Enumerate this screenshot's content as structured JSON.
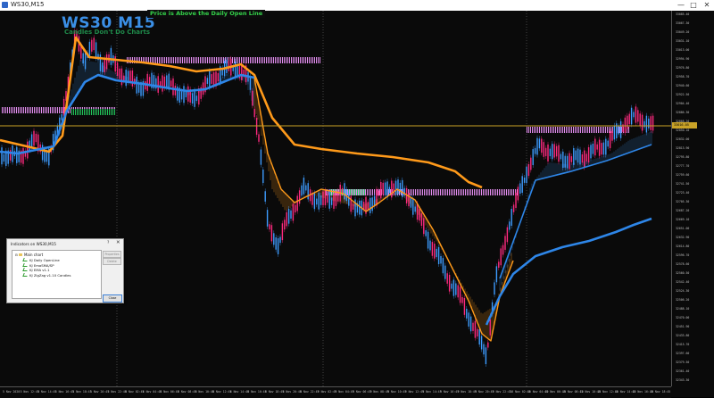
{
  "window": {
    "title": "WS30,M15",
    "minimize": "—",
    "maximize": "□",
    "close": "✕"
  },
  "chart": {
    "symbol_timeframe": "WS30 M15",
    "watermark": "Candles Don't Do Charts",
    "status_banner": "Price is Above the Daily Open Line",
    "current_price": "33016.05",
    "colors": {
      "bull_candle": "#3d9cff",
      "bear_candle": "#ff2a7f",
      "ema_slow": "#2e86e8",
      "orange_line": "#ff9a1a",
      "daily_open_line": "#c9a227",
      "zone": "#e38df0",
      "zone_green": "#22c35a"
    },
    "price_ticks": [
      "33085.40",
      "33067.30",
      "33049.20",
      "33031.10",
      "33013.00",
      "32994.90",
      "32976.80",
      "32958.70",
      "32940.60",
      "32922.50",
      "32904.40",
      "32886.30",
      "32868.20",
      "32850.10",
      "32832.00",
      "32813.90",
      "32795.80",
      "32777.70",
      "32759.60",
      "32741.50",
      "32723.40",
      "32705.30",
      "32687.20",
      "32669.10",
      "32651.00",
      "32632.90",
      "32614.80",
      "32596.70",
      "32578.60",
      "32560.50",
      "32542.40",
      "32524.30",
      "32506.20",
      "32488.10",
      "32470.00",
      "32451.90",
      "32433.80",
      "32415.70",
      "32397.60",
      "32379.50",
      "32361.40",
      "32343.30"
    ],
    "time_ticks": [
      "5 Nov 2020",
      "5 Nov 12:45",
      "5 Nov 14:45",
      "5 Nov 16:45",
      "5 Nov 18:45",
      "5 Nov 20:45",
      "5 Nov 22:45",
      "6 Nov 02:45",
      "6 Nov 04:45",
      "6 Nov 06:45",
      "6 Nov 08:45",
      "6 Nov 10:45",
      "6 Nov 12:45",
      "6 Nov 14:45",
      "6 Nov 16:45",
      "6 Nov 18:45",
      "6 Nov 20:45",
      "6 Nov 22:45",
      "9 Nov 02:45",
      "9 Nov 04:45",
      "9 Nov 06:45",
      "9 Nov 08:45",
      "9 Nov 10:45",
      "9 Nov 12:45",
      "9 Nov 14:45",
      "9 Nov 16:45",
      "9 Nov 18:45",
      "9 Nov 20:45",
      "9 Nov 22:45",
      "10 Nov 02:45",
      "10 Nov 04:45",
      "10 Nov 06:45",
      "10 Nov 08:45",
      "10 Nov 10:45",
      "10 Nov 12:45",
      "10 Nov 14:45",
      "10 Nov 16:45",
      "10 Nov 18:45"
    ]
  },
  "dialog": {
    "title": "Indicators on WS30,M15",
    "help": "?",
    "close_x": "✕",
    "tree_root": "Main chart",
    "items": [
      "KJ Daily OpenLine",
      "KJ EmaSMA/SP",
      "KJ EMA v1.1",
      "KJ ZigZag v1.10 Candles"
    ],
    "properties_label": "Properties",
    "delete_label": "Delete",
    "close_label": "Close"
  }
}
